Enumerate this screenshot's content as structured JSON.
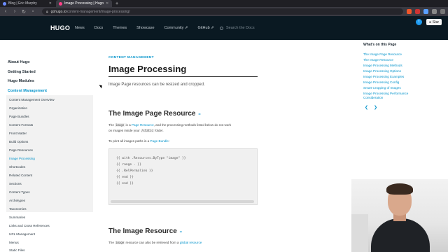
{
  "browser": {
    "tabs": [
      {
        "label": "Blog | Eric Murphy",
        "active": false,
        "favicon_color": "#6c8cff"
      },
      {
        "label": "Image Processing | Hugo",
        "active": true,
        "favicon_color": "#ff4088"
      }
    ],
    "new_tab_label": "+",
    "url_host": "gohugo.io",
    "url_path": "/content-management/image-processing/"
  },
  "header": {
    "logo": "HUGO",
    "nav": [
      "News",
      "Docs",
      "Themes",
      "Showcase",
      "Community ⇗",
      "GitHub ⇗"
    ],
    "search_placeholder": "Search the Docs",
    "star_label": "Star"
  },
  "sidebar": {
    "sections": [
      {
        "label": "About Hugo",
        "active": false
      },
      {
        "label": "Getting Started",
        "active": false
      },
      {
        "label": "Hugo Modules",
        "active": false
      },
      {
        "label": "Content Management",
        "active": true
      }
    ],
    "subitems": [
      {
        "label": "Content Management Overview",
        "current": false
      },
      {
        "label": "Organization",
        "current": false
      },
      {
        "label": "Page Bundles",
        "current": false
      },
      {
        "label": "Content Formats",
        "current": false
      },
      {
        "label": "Front Matter",
        "current": false
      },
      {
        "label": "Build Options",
        "current": false
      },
      {
        "label": "Page Resources",
        "current": false
      },
      {
        "label": "Image Processing",
        "current": true
      },
      {
        "label": "Shortcodes",
        "current": false
      },
      {
        "label": "Related Content",
        "current": false
      },
      {
        "label": "Sections",
        "current": false
      },
      {
        "label": "Content Types",
        "current": false
      },
      {
        "label": "Archetypes",
        "current": false
      },
      {
        "label": "Taxonomies",
        "current": false
      },
      {
        "label": "Summaries",
        "current": false
      },
      {
        "label": "Links and Cross References",
        "current": false
      },
      {
        "label": "URL Management",
        "current": false
      },
      {
        "label": "Menus",
        "current": false
      },
      {
        "label": "Static Files",
        "current": false
      }
    ]
  },
  "main": {
    "kicker": "CONTENT MANAGEMENT",
    "title": "Image Processing",
    "lead": "Image Page resources can be resized and cropped.",
    "section1": {
      "heading": "The Image Page Resource",
      "p1_a": "The ",
      "p1_code1": "image",
      "p1_b": " is a ",
      "p1_link": "Page Resource",
      "p1_c": ", and the processing methods listed below do not work",
      "p1_line2_a": "on images inside your ",
      "p1_code2": "/static",
      "p1_line2_b": " folder.",
      "p2_a": "To print all images paths in a ",
      "p2_link": "Page Bundle",
      "p2_b": ":",
      "code_lines": [
        "{{ with .Resources.ByType \"image\" }}",
        "{{ range . }}",
        "{{ .RelPermalink }}",
        "{{ end }}",
        "{{ end }}"
      ]
    },
    "section2": {
      "heading": "The Image Resource",
      "p_code": "image",
      "p_a": " resource can also be retrieved from a ",
      "p_link": "global resource",
      "p_prefix": "The "
    }
  },
  "toc": {
    "title": "What's on this Page",
    "items": [
      "The Image Page Resource",
      "The Image Resource",
      "Image Processing Methods",
      "Image Processing Options",
      "Image Processing Examples",
      "Image Processing Config",
      "Smart Cropping of Images",
      "Image Processing Performance Consideration"
    ],
    "prev": "❮",
    "next": "❯"
  },
  "colors": {
    "accent": "#0594cb",
    "header_bg": "#0a1922"
  }
}
